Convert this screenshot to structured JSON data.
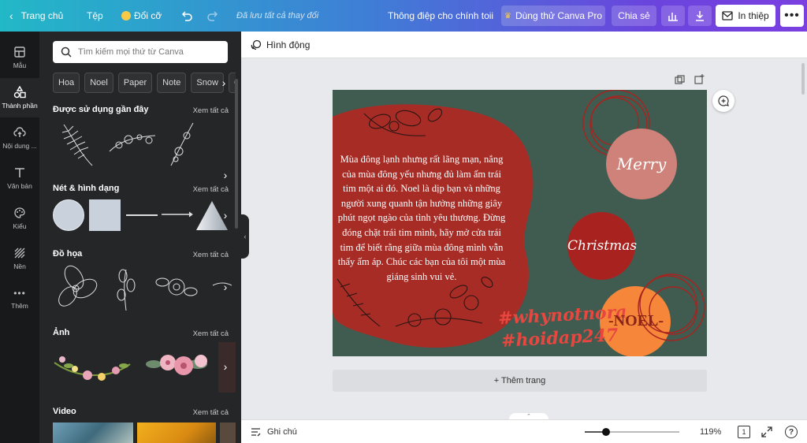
{
  "topbar": {
    "home": "Trang chủ",
    "file": "Tệp",
    "resize": "Đổi cỡ",
    "saved": "Đã lưu tất cả thay đổi",
    "doc_title": "Thông điệp cho chính toii",
    "pro": "Dùng thử Canva Pro",
    "share": "Chia sẻ",
    "print": "In thiệp"
  },
  "rail": [
    {
      "label": "Mẫu"
    },
    {
      "label": "Thành phần"
    },
    {
      "label": "Nội dung ..."
    },
    {
      "label": "Văn bản"
    },
    {
      "label": "Kiểu"
    },
    {
      "label": "Nền"
    },
    {
      "label": "Thêm"
    }
  ],
  "panel": {
    "search_placeholder": "Tìm kiếm mọi thứ từ Canva",
    "chips": [
      "Hoa",
      "Noel",
      "Paper",
      "Note",
      "Snow",
      "Ch"
    ],
    "see_all": "Xem tất cả",
    "sections": {
      "recent": "Được sử dụng gần đây",
      "lines": "Nét & hình dạng",
      "graphics": "Đồ họa",
      "photos": "Ảnh",
      "videos": "Video"
    }
  },
  "editor": {
    "animate": "Hình động",
    "add_page": "+ Thêm trang",
    "notes": "Ghi chú",
    "zoom_percent": 119,
    "zoom_label": "119%",
    "page_count": "1",
    "help": "?"
  },
  "card": {
    "message": "Mùa đông lạnh nhưng rất lãng mạn, nắng của mùa đông yếu nhưng đủ làm ấm trái tim một ai đó. Noel là dịp bạn và những người xung quanh tận hưởng những giây phút ngọt ngào của tình yêu thương. Đừng đóng chặt trái tim mình, hãy mở cửa trái tim để biết rằng giữa mùa đông mình vẫn thấy ấm áp. Chúc các bạn của tôi một mùa giáng sinh vui vẻ.",
    "merry": "Merry",
    "christmas": "Christmas",
    "hashtag1": "#whynotnora",
    "hashtag2": "#hoidap247",
    "noel": "-NOEL-"
  },
  "colors": {
    "canvas_bg": "#405c50",
    "blob_red": "#a72c26",
    "pink_circle": "#cf8279",
    "red_circle": "#a8231f",
    "orange_circle": "#f5863a",
    "hashtag": "#e8473f"
  }
}
